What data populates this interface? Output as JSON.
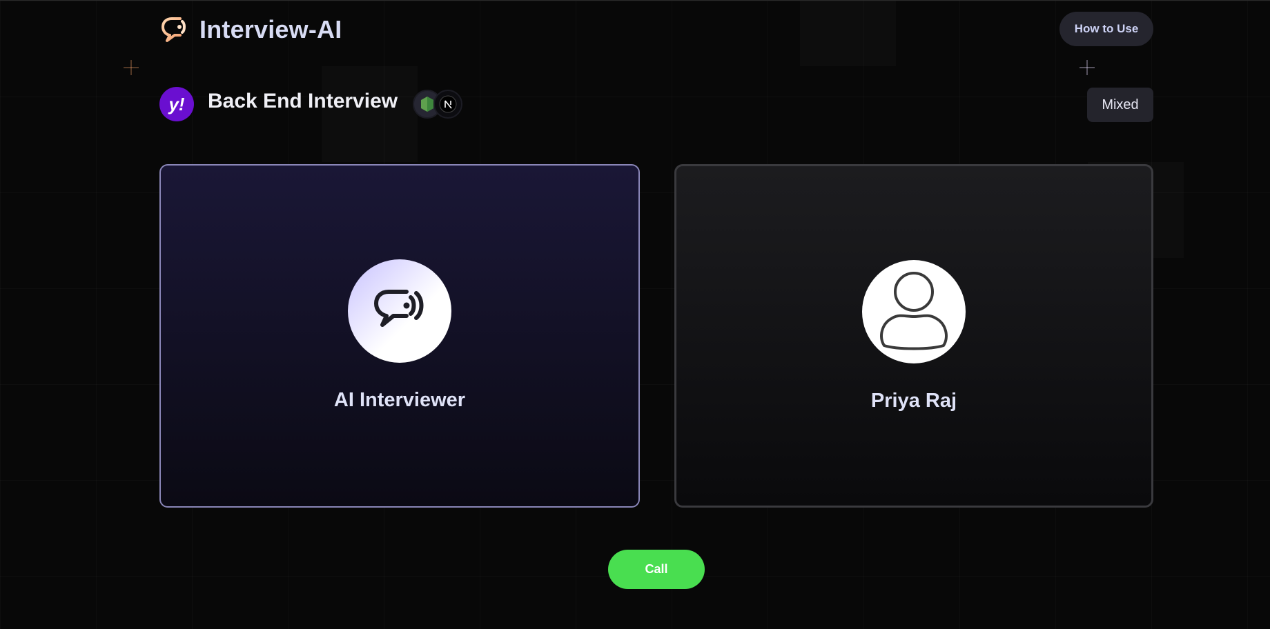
{
  "header": {
    "app_name": "Interview-AI",
    "how_to_use_label": "How to Use",
    "logo_icon": "chat-bubble-logo-icon"
  },
  "interview": {
    "company_logo_icon": "yahoo-logo-icon",
    "company_logo_text": "y!",
    "title": "Back End Interview",
    "tech_stack": [
      {
        "icon": "nodejs-icon"
      },
      {
        "icon": "nextjs-icon"
      }
    ],
    "type": "Mixed"
  },
  "cards": {
    "ai": {
      "name": "AI Interviewer",
      "avatar_icon": "ai-chat-avatar-icon"
    },
    "user": {
      "name": "Priya Raj",
      "avatar_icon": "user-avatar-icon"
    }
  },
  "controls": {
    "call_label": "Call"
  },
  "colors": {
    "background": "#080808",
    "accent_purple": "#8a86b8",
    "call_green": "#49de50",
    "company_purple": "#6a0fd0"
  }
}
